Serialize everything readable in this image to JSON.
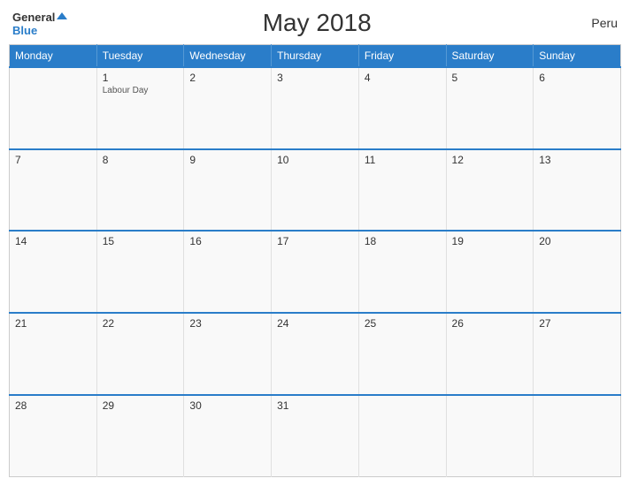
{
  "header": {
    "title": "May 2018",
    "country": "Peru",
    "logo_general": "General",
    "logo_blue": "Blue"
  },
  "calendar": {
    "days_of_week": [
      "Monday",
      "Tuesday",
      "Wednesday",
      "Thursday",
      "Friday",
      "Saturday",
      "Sunday"
    ],
    "weeks": [
      [
        {
          "date": "",
          "event": ""
        },
        {
          "date": "1",
          "event": "Labour Day"
        },
        {
          "date": "2",
          "event": ""
        },
        {
          "date": "3",
          "event": ""
        },
        {
          "date": "4",
          "event": ""
        },
        {
          "date": "5",
          "event": ""
        },
        {
          "date": "6",
          "event": ""
        }
      ],
      [
        {
          "date": "7",
          "event": ""
        },
        {
          "date": "8",
          "event": ""
        },
        {
          "date": "9",
          "event": ""
        },
        {
          "date": "10",
          "event": ""
        },
        {
          "date": "11",
          "event": ""
        },
        {
          "date": "12",
          "event": ""
        },
        {
          "date": "13",
          "event": ""
        }
      ],
      [
        {
          "date": "14",
          "event": ""
        },
        {
          "date": "15",
          "event": ""
        },
        {
          "date": "16",
          "event": ""
        },
        {
          "date": "17",
          "event": ""
        },
        {
          "date": "18",
          "event": ""
        },
        {
          "date": "19",
          "event": ""
        },
        {
          "date": "20",
          "event": ""
        }
      ],
      [
        {
          "date": "21",
          "event": ""
        },
        {
          "date": "22",
          "event": ""
        },
        {
          "date": "23",
          "event": ""
        },
        {
          "date": "24",
          "event": ""
        },
        {
          "date": "25",
          "event": ""
        },
        {
          "date": "26",
          "event": ""
        },
        {
          "date": "27",
          "event": ""
        }
      ],
      [
        {
          "date": "28",
          "event": ""
        },
        {
          "date": "29",
          "event": ""
        },
        {
          "date": "30",
          "event": ""
        },
        {
          "date": "31",
          "event": ""
        },
        {
          "date": "",
          "event": ""
        },
        {
          "date": "",
          "event": ""
        },
        {
          "date": "",
          "event": ""
        }
      ]
    ]
  }
}
